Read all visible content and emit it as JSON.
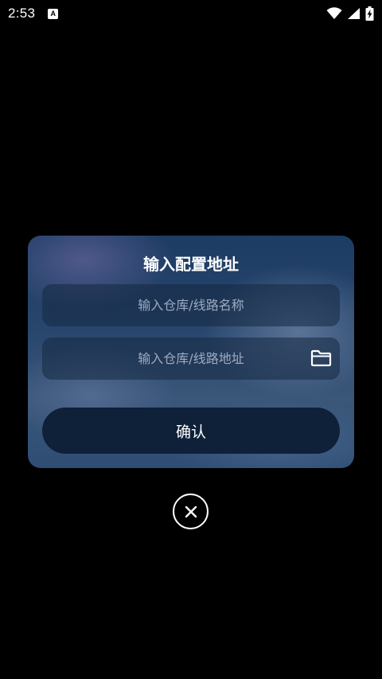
{
  "status_bar": {
    "time": "2:53",
    "notification_icon": "a-letter-icon",
    "notification_glyph": "A",
    "wifi_icon": "wifi-icon",
    "signal_icon": "signal-icon",
    "battery_icon": "battery-charging-icon"
  },
  "dialog": {
    "title": "输入配置地址",
    "name_input": {
      "placeholder": "输入仓库/线路名称",
      "value": ""
    },
    "url_input": {
      "placeholder": "输入仓库/线路地址",
      "value": ""
    },
    "folder_icon": "folder-icon",
    "confirm_label": "确认"
  },
  "close_icon": "close-icon",
  "colors": {
    "background": "#000000",
    "dialog_top": "#1d3c63",
    "confirm_button": "#0f2039",
    "text": "#ffffff"
  }
}
